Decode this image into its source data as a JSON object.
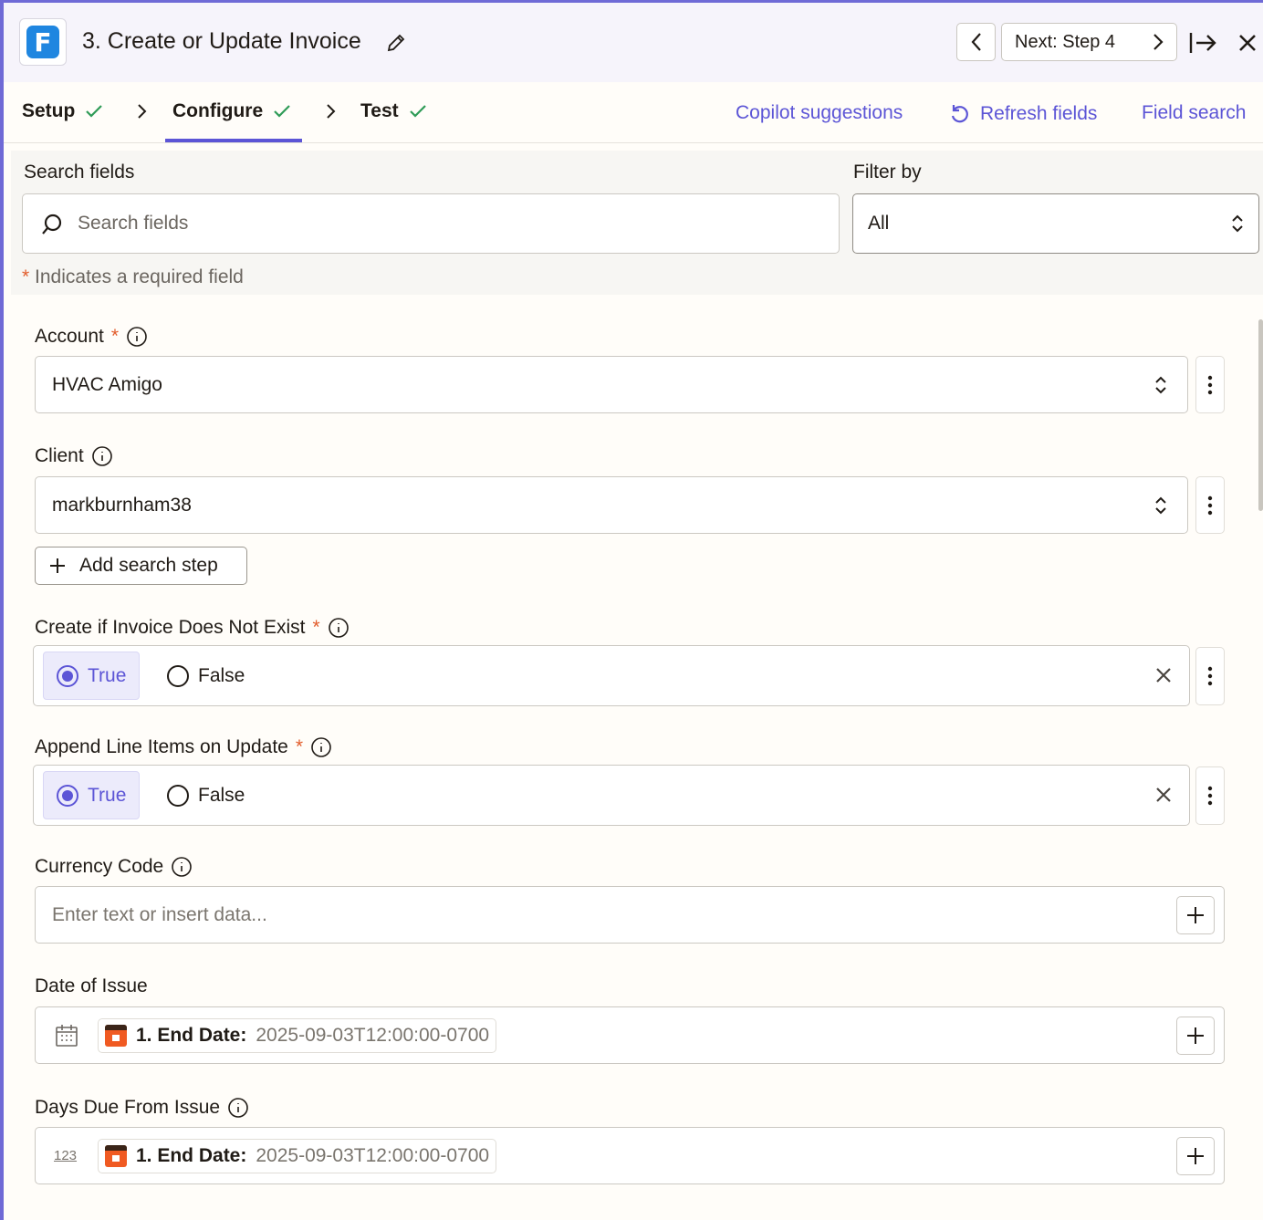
{
  "header": {
    "title": "3. Create or Update Invoice",
    "logo_letter": "F",
    "next_label": "Next: Step 4"
  },
  "tabs": [
    {
      "label": "Setup"
    },
    {
      "label": "Configure"
    },
    {
      "label": "Test"
    }
  ],
  "links": {
    "copilot": "Copilot suggestions",
    "refresh": "Refresh fields",
    "field_search": "Field search"
  },
  "search": {
    "label": "Search fields",
    "placeholder": "Search fields",
    "filter_label": "Filter by",
    "filter_value": "All",
    "required_note": "Indicates a required field",
    "required_star": "*"
  },
  "fields": {
    "account": {
      "label": "Account",
      "value": "HVAC Amigo"
    },
    "client": {
      "label": "Client",
      "value": "markburnham38"
    },
    "add_search_step": "Add search step",
    "create_if_not_exist": {
      "label": "Create if Invoice Does Not Exist",
      "true_label": "True",
      "false_label": "False"
    },
    "append_line_items": {
      "label": "Append Line Items on Update",
      "true_label": "True",
      "false_label": "False"
    },
    "currency_code": {
      "label": "Currency Code",
      "placeholder": "Enter text or insert data..."
    },
    "date_of_issue": {
      "label": "Date of Issue",
      "pill_key": "1. End Date:",
      "pill_value": "2025-09-03T12:00:00-0700"
    },
    "days_due": {
      "label": "Days Due From Issue",
      "type_icon": "123",
      "pill_key": "1. End Date:",
      "pill_value": "2025-09-03T12:00:00-0700"
    }
  },
  "colors": {
    "accent": "#5c55d6",
    "required": "#e25d2c",
    "success": "#2e9b57",
    "app_brand": "#1f86e0",
    "bookly": "#f05a22"
  }
}
